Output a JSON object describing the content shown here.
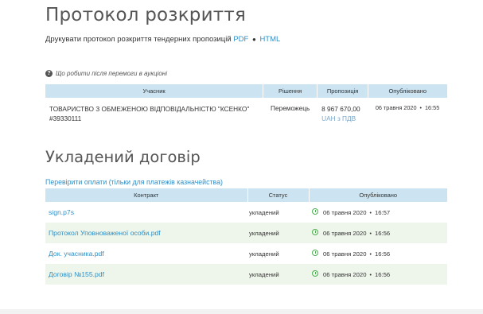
{
  "protocol": {
    "title": "Протокол розкриття",
    "print_text": "Друкувати протокол розкриття тендерних пропозицій",
    "pdf_label": "PDF",
    "separator": "●",
    "html_label": "HTML",
    "help_text": "Що робити після перемоги в аукціоні",
    "columns": [
      "Учасник",
      "Рішення",
      "Пропозиція",
      "Опубліковано"
    ],
    "row": {
      "participant": "ТОВАРИСТВО З ОБМЕЖЕНОЮ ВІДПОВІДАЛЬНІСТЮ \"КСЕНКО\"",
      "participant_id": "#39330111",
      "decision": "Переможець",
      "amount": "8 967 670,00",
      "currency": "UAH з ПДВ",
      "date": "06 травня 2020",
      "time": "16:55"
    }
  },
  "contract": {
    "title": "Укладений договір",
    "check_payments_link": "Перевірити оплати (тільки для платежів казначейства)",
    "columns": [
      "Контракт",
      "Статус",
      "Опубліковано"
    ],
    "rows": [
      {
        "name": "sign.p7s",
        "status": "укладений",
        "date": "06 травня 2020",
        "time": "16:57"
      },
      {
        "name": "Протокол Уповноваженої особи.pdf",
        "status": "укладений",
        "date": "06 травня 2020",
        "time": "16:56"
      },
      {
        "name": "Док. учасника.pdf",
        "status": "укладений",
        "date": "06 травня 2020",
        "time": "16:56"
      },
      {
        "name": "Договір №155.pdf",
        "status": "укладений",
        "date": "06 травня 2020",
        "time": "16:56"
      }
    ]
  },
  "colors": {
    "link": "#2f8fc6",
    "header_bg": "#cce4f2",
    "alt_row_bg": "#eef5ea",
    "clock": "#4caf50"
  }
}
